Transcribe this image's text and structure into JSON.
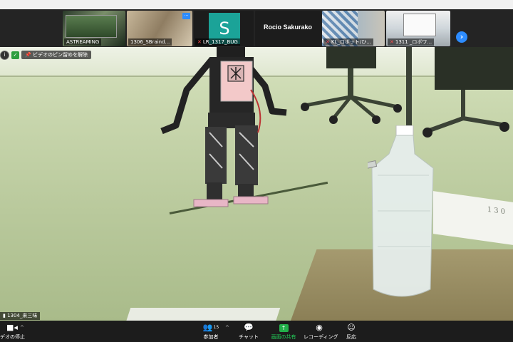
{
  "participants": [
    {
      "name": "ASTREAMING",
      "muted": false
    },
    {
      "name": "1306_SBraind...",
      "muted": false
    },
    {
      "name": "LR_1317_BUG",
      "muted": true,
      "initial": "S",
      "avatar_color": "#1ba398"
    },
    {
      "name": "Rocio Sakurako",
      "muted": false
    },
    {
      "name": "KL_ロボット/ひ...",
      "muted": true
    },
    {
      "name": "1311 _ロボワ...",
      "muted": true
    }
  ],
  "pin_banner": {
    "label": "ビデオのピン留めを解除"
  },
  "speaker_label": "1304_来三味",
  "paper_text": "130",
  "toolbar": {
    "video": "デオの停止",
    "participants": "参加者",
    "participants_count": "15",
    "chat": "チャット",
    "share": "画面の共有",
    "record": "レコーディング",
    "reactions": "反応"
  },
  "colors": {
    "accent": "#2d8cff",
    "share": "#22b04a",
    "muted": "#ff4a4a"
  }
}
